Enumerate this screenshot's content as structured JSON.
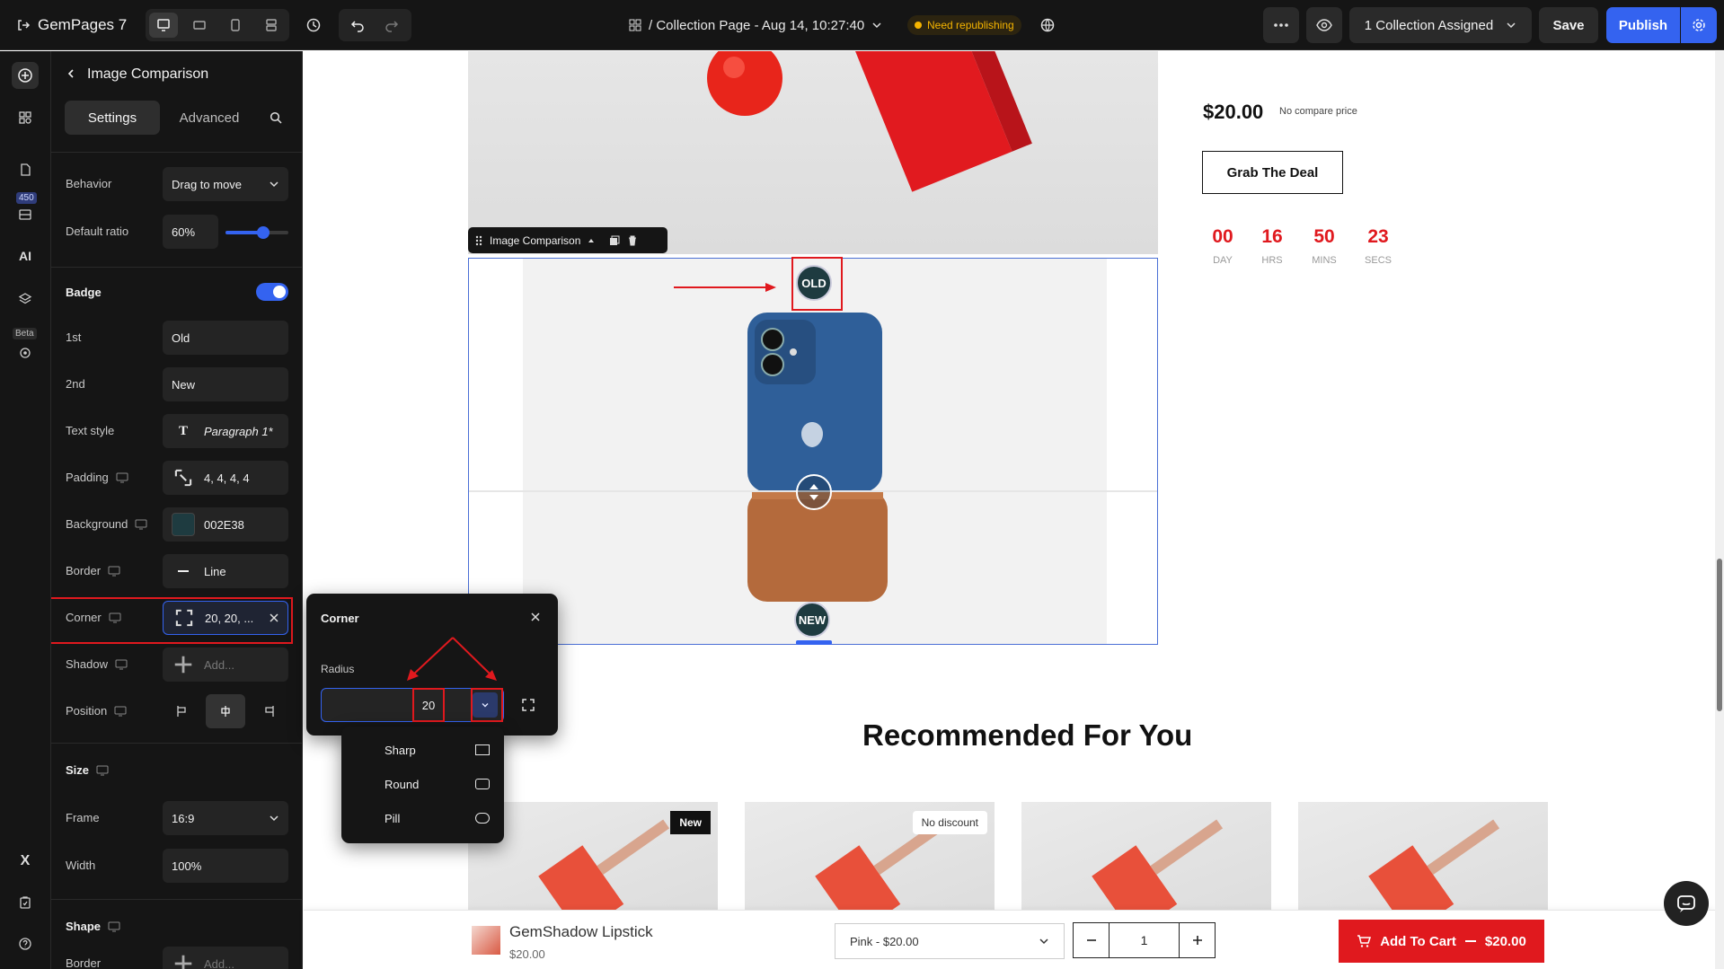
{
  "topbar": {
    "brand": "GemPages 7",
    "page_title": "/ Collection Page - Aug 14, 10:27:40",
    "status": "Need republishing",
    "collection_assigned": "1 Collection Assigned",
    "save": "Save",
    "publish": "Publish",
    "icons": [
      "exit-icon",
      "desktop-icon",
      "tablet-landscape-icon",
      "mobile-icon",
      "layout-icon",
      "history-icon",
      "undo-icon",
      "redo-icon",
      "grid-icon",
      "translate-icon",
      "more-icon",
      "eye-icon",
      "chevron-down-icon",
      "gear-icon"
    ]
  },
  "rail": {
    "badge": "450",
    "beta": "Beta",
    "icons": [
      "add-icon",
      "sections-icon",
      "pages-icon",
      "library-icon",
      "ai-icon",
      "layers-icon",
      "settings-beta-icon",
      "x-icon",
      "clipboard-icon",
      "help-icon"
    ]
  },
  "panel": {
    "title": "Image Comparison",
    "tabs": {
      "settings": "Settings",
      "advanced": "Advanced"
    },
    "behavior": {
      "label": "Behavior",
      "value": "Drag to move"
    },
    "default_ratio": {
      "label": "Default ratio",
      "value": "60%",
      "level": 0.6
    },
    "badge": {
      "label": "Badge",
      "enabled": true
    },
    "first": {
      "label": "1st",
      "value": "Old"
    },
    "second": {
      "label": "2nd",
      "value": "New"
    },
    "text_style": {
      "label": "Text style",
      "value": "Paragraph 1*"
    },
    "padding": {
      "label": "Padding",
      "value": "4, 4, 4, 4"
    },
    "background": {
      "label": "Background",
      "value": "002E38",
      "color": "#1e3b40"
    },
    "border": {
      "label": "Border",
      "value": "Line"
    },
    "corner": {
      "label": "Corner",
      "value": "20, 20, ..."
    },
    "shadow": {
      "label": "Shadow",
      "value": "Add..."
    },
    "position": {
      "label": "Position"
    },
    "size": {
      "label": "Size"
    },
    "frame": {
      "label": "Frame",
      "value": "16:9"
    },
    "width": {
      "label": "Width",
      "value": "100%"
    },
    "shape": {
      "label": "Shape"
    },
    "shape_border": {
      "label": "Border",
      "value": "Add..."
    }
  },
  "corner_popup": {
    "title": "Corner",
    "radius_label": "Radius",
    "radius_value": "20",
    "options": [
      "Sharp",
      "Round",
      "Pill"
    ]
  },
  "canvas": {
    "price": "$20.00",
    "compare_price": "No compare price",
    "deal_button": "Grab The Deal",
    "countdown": [
      {
        "value": "00",
        "unit": "DAY"
      },
      {
        "value": "16",
        "unit": "HRS"
      },
      {
        "value": "50",
        "unit": "MINS"
      },
      {
        "value": "23",
        "unit": "SECS"
      }
    ],
    "element_toolbar": "Image Comparison",
    "badge_old": "OLD",
    "badge_new": "NEW",
    "recommended": "Recommended For You",
    "product_tags": [
      "New",
      "No discount"
    ]
  },
  "sticky": {
    "name": "GemShadow Lipstick",
    "price": "$20.00",
    "variant": "Pink - $20.00",
    "qty": "1",
    "add_to_cart": "Add To Cart",
    "atc_price": "$20.00"
  },
  "colors": {
    "accent": "#3463f0",
    "danger": "#e0191e",
    "warning": "#f5b400",
    "badge_bg": "#1e3b40"
  }
}
